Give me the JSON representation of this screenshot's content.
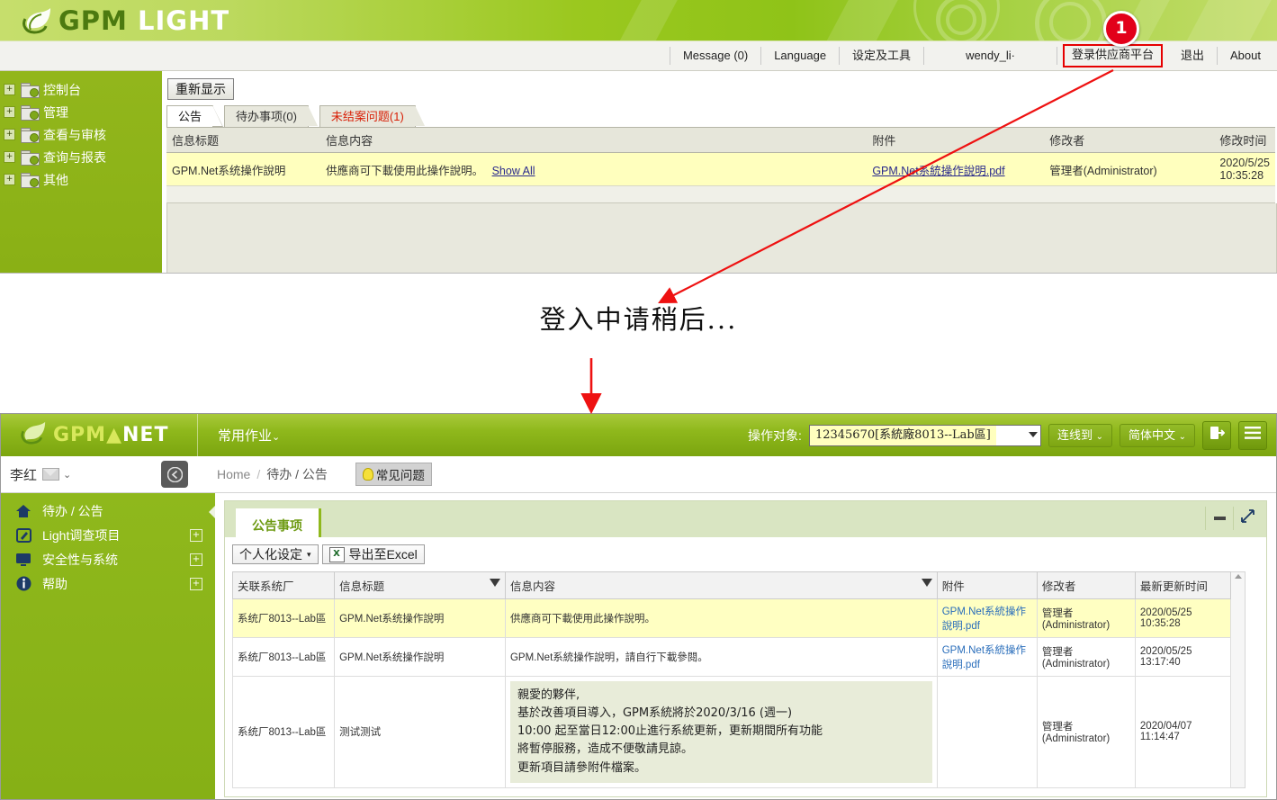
{
  "top_app": {
    "logo": {
      "part1": "GPM",
      "part2": "LIGHT"
    },
    "nav": {
      "message": "Message (0)",
      "language": "Language",
      "settings_tools": "设定及工具",
      "user": "wendy_li·",
      "supplier_platform": "登录供应商平台",
      "logout": "退出",
      "about": "About"
    },
    "annotation_badge": "1",
    "sidebar": [
      {
        "label": "控制台",
        "expander": "+"
      },
      {
        "label": "管理",
        "expander": "+"
      },
      {
        "label": "查看与审核",
        "expander": "+"
      },
      {
        "label": "查询与报表",
        "expander": "+"
      },
      {
        "label": "其他",
        "expander": "+"
      }
    ],
    "refresh_button": "重新显示",
    "tabs": [
      {
        "label": "公告",
        "active": true
      },
      {
        "label": "待办事项(0)",
        "active": false
      },
      {
        "label": "未结案问题(1)",
        "active": false
      }
    ],
    "table": {
      "headers": [
        "信息标题",
        "信息内容",
        "附件",
        "修改者",
        "修改时间"
      ],
      "rows": [
        {
          "title": "GPM.Net系统操作說明",
          "content": "供應商可下載使用此操作說明。",
          "show_all": "Show All",
          "attachment": "GPM.Net系統操作說明.pdf",
          "modifier": "管理者(Administrator)",
          "modified": "2020/5/25 10:35:28"
        }
      ]
    }
  },
  "middle": {
    "loading_text": "登入中请稍后..."
  },
  "bottom_app": {
    "logo": {
      "part1": "GPM",
      "part2": "NET"
    },
    "menu": "常用作业",
    "object_label": "操作对象:",
    "object_value": "12345670[系統廠8013--Lab區]",
    "connect_to": "连线到",
    "language": "简体中文",
    "logout_icon": "logout-icon",
    "menu_icon": "hamburger-icon",
    "user_name": "李红",
    "breadcrumb": [
      "Home",
      "待办 / 公告"
    ],
    "faq_button": "常见问题",
    "sidebar": [
      {
        "label": "待办 / 公告",
        "icon": "home-icon",
        "expander": ""
      },
      {
        "label": "Light调查项目",
        "icon": "edit-icon",
        "expander": "+"
      },
      {
        "label": "安全性与系统",
        "icon": "monitor-icon",
        "expander": "+"
      },
      {
        "label": "帮助",
        "icon": "info-icon",
        "expander": "+"
      }
    ],
    "panel": {
      "tab": "公告事项",
      "toolbar": {
        "personalize": "个人化设定",
        "export_excel": "导出至Excel",
        "excel_icon_text": "X"
      },
      "grid": {
        "headers": [
          "关联系统厂",
          "信息标题",
          "信息内容",
          "附件",
          "修改者",
          "最新更新时间"
        ],
        "rows": [
          {
            "plant": "系统厂8013--Lab區",
            "title": "GPM.Net系统操作說明",
            "content": "供應商可下載使用此操作說明。",
            "attachment": "GPM.Net系統操作說明.pdf",
            "modifier": "管理者 (Administrator)",
            "updated": "2020/05/25 10:35:28",
            "highlight": true,
            "boxed": false
          },
          {
            "plant": "系统厂8013--Lab區",
            "title": "GPM.Net系统操作說明",
            "content": "GPM.Net系統操作說明，請自行下載參閱。",
            "attachment": "GPM.Net系統操作說明.pdf",
            "modifier": "管理者 (Administrator)",
            "updated": "2020/05/25 13:17:40",
            "highlight": false,
            "boxed": false
          },
          {
            "plant": "系统厂8013--Lab區",
            "title": "测试测试",
            "content": "親愛的夥伴,\n基於改善項目導入，GPM系統將於2020/3/16 (週一)\n10:00 起至當日12:00止進行系統更新，更新期間所有功能\n將暫停服務，造成不便敬請見諒。\n更新項目請參附件檔案。",
            "attachment": "",
            "modifier": "管理者 (Administrator)",
            "updated": "2020/04/07 11:14:47",
            "highlight": false,
            "boxed": true
          }
        ]
      }
    }
  },
  "colors": {
    "brand_green": "#8fb81c",
    "header_light": "#9bc81f",
    "highlight_row": "#ffffc2",
    "alert_red": "#d81e05",
    "annotation_red": "#e2001a"
  }
}
